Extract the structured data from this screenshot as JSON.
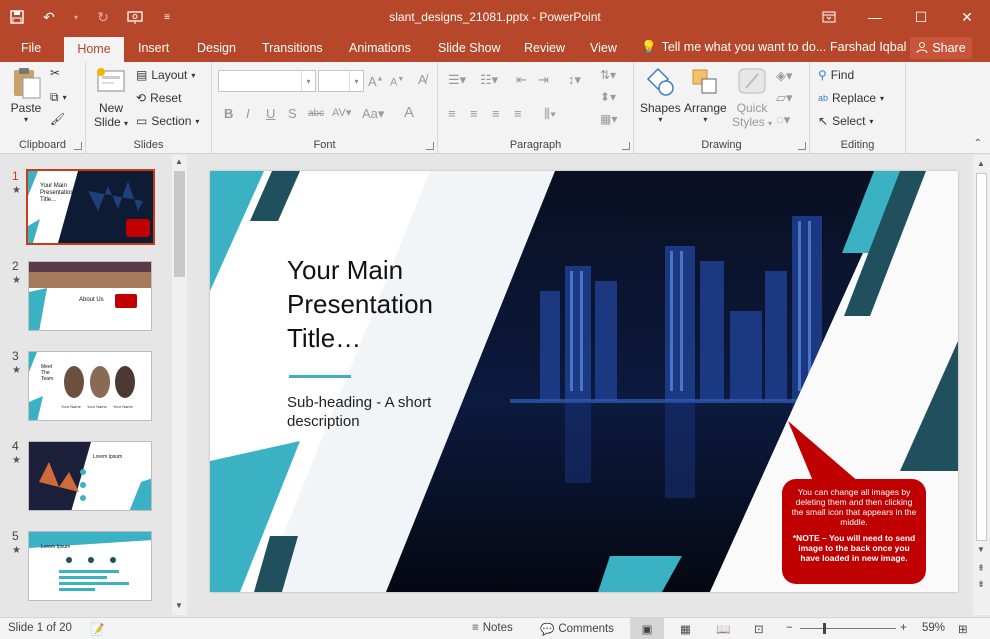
{
  "window": {
    "title": "slant_designs_21081.pptx - PowerPoint",
    "accent": "#b7472a"
  },
  "tabs": [
    "File",
    "Home",
    "Insert",
    "Design",
    "Transitions",
    "Animations",
    "Slide Show",
    "Review",
    "View"
  ],
  "active_tab": "Home",
  "tell_me": "Tell me what you want to do...",
  "user": "Farshad Iqbal",
  "share": "Share",
  "ribbon": {
    "clipboard": {
      "label": "Clipboard",
      "paste": "Paste"
    },
    "slides": {
      "label": "Slides",
      "new_slide": "New",
      "new_slide2": "Slide",
      "layout": "Layout",
      "reset": "Reset",
      "section": "Section"
    },
    "font": {
      "label": "Font"
    },
    "paragraph": {
      "label": "Paragraph"
    },
    "drawing": {
      "label": "Drawing",
      "shapes": "Shapes",
      "arrange": "Arrange",
      "quick_styles": "Quick",
      "quick_styles2": "Styles"
    },
    "editing": {
      "label": "Editing",
      "find": "Find",
      "replace": "Replace",
      "select": "Select"
    }
  },
  "thumbnails": [
    {
      "num": "1",
      "active": true,
      "title": "Your Main Presentation Title..."
    },
    {
      "num": "2",
      "active": false,
      "title": "About Us"
    },
    {
      "num": "3",
      "active": false,
      "title": "Meet The Team"
    },
    {
      "num": "4",
      "active": false,
      "title": "Lorem Ipsum"
    },
    {
      "num": "5",
      "active": false,
      "title": "Lorem Ipsum"
    }
  ],
  "thumb3_names": [
    "Your Name",
    "Your Name",
    "Your Name"
  ],
  "slide": {
    "title": "Your Main Presentation Title…",
    "subtitle": "Sub-heading - A short description",
    "callout_text": "You can change all images by deleting them and then clicking the small icon that appears in the middle.",
    "callout_note": "*NOTE – You will need to send image to the back once you have loaded in new image.",
    "colors": {
      "teal": "#3bb1c4",
      "dark_teal": "#20505e",
      "callout": "#c00000"
    }
  },
  "status": {
    "slide_of": "Slide 1 of 20",
    "notes": "Notes",
    "comments": "Comments",
    "zoom": "59%"
  }
}
